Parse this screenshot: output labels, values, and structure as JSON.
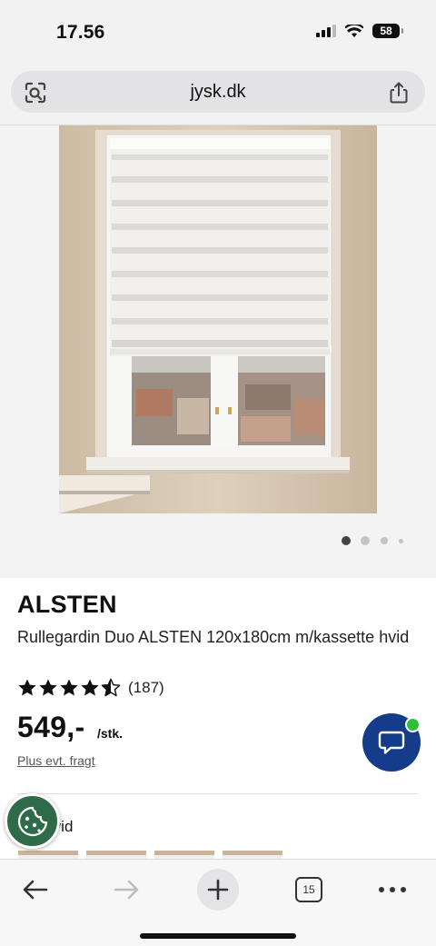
{
  "status_bar": {
    "time": "17.56",
    "battery": "58"
  },
  "browser": {
    "url": "jysk.dk",
    "tab_count": "15"
  },
  "gallery": {
    "dot_count": 4,
    "active_dot": 1
  },
  "product": {
    "brand": "ALSTEN",
    "description": "Rullegardin Duo ALSTEN 120x180cm m/kassette hvid",
    "rating": 4.5,
    "rating_count": "(187)",
    "price": "549,-",
    "unit": "/stk.",
    "shipping_note": "Plus evt. fragt",
    "color_label": ":",
    "color_value": "Hvid"
  },
  "colors": {
    "chat_button": "#143c8a",
    "chat_status": "#2dbe3c",
    "cookie_button": "#2f6b49"
  }
}
